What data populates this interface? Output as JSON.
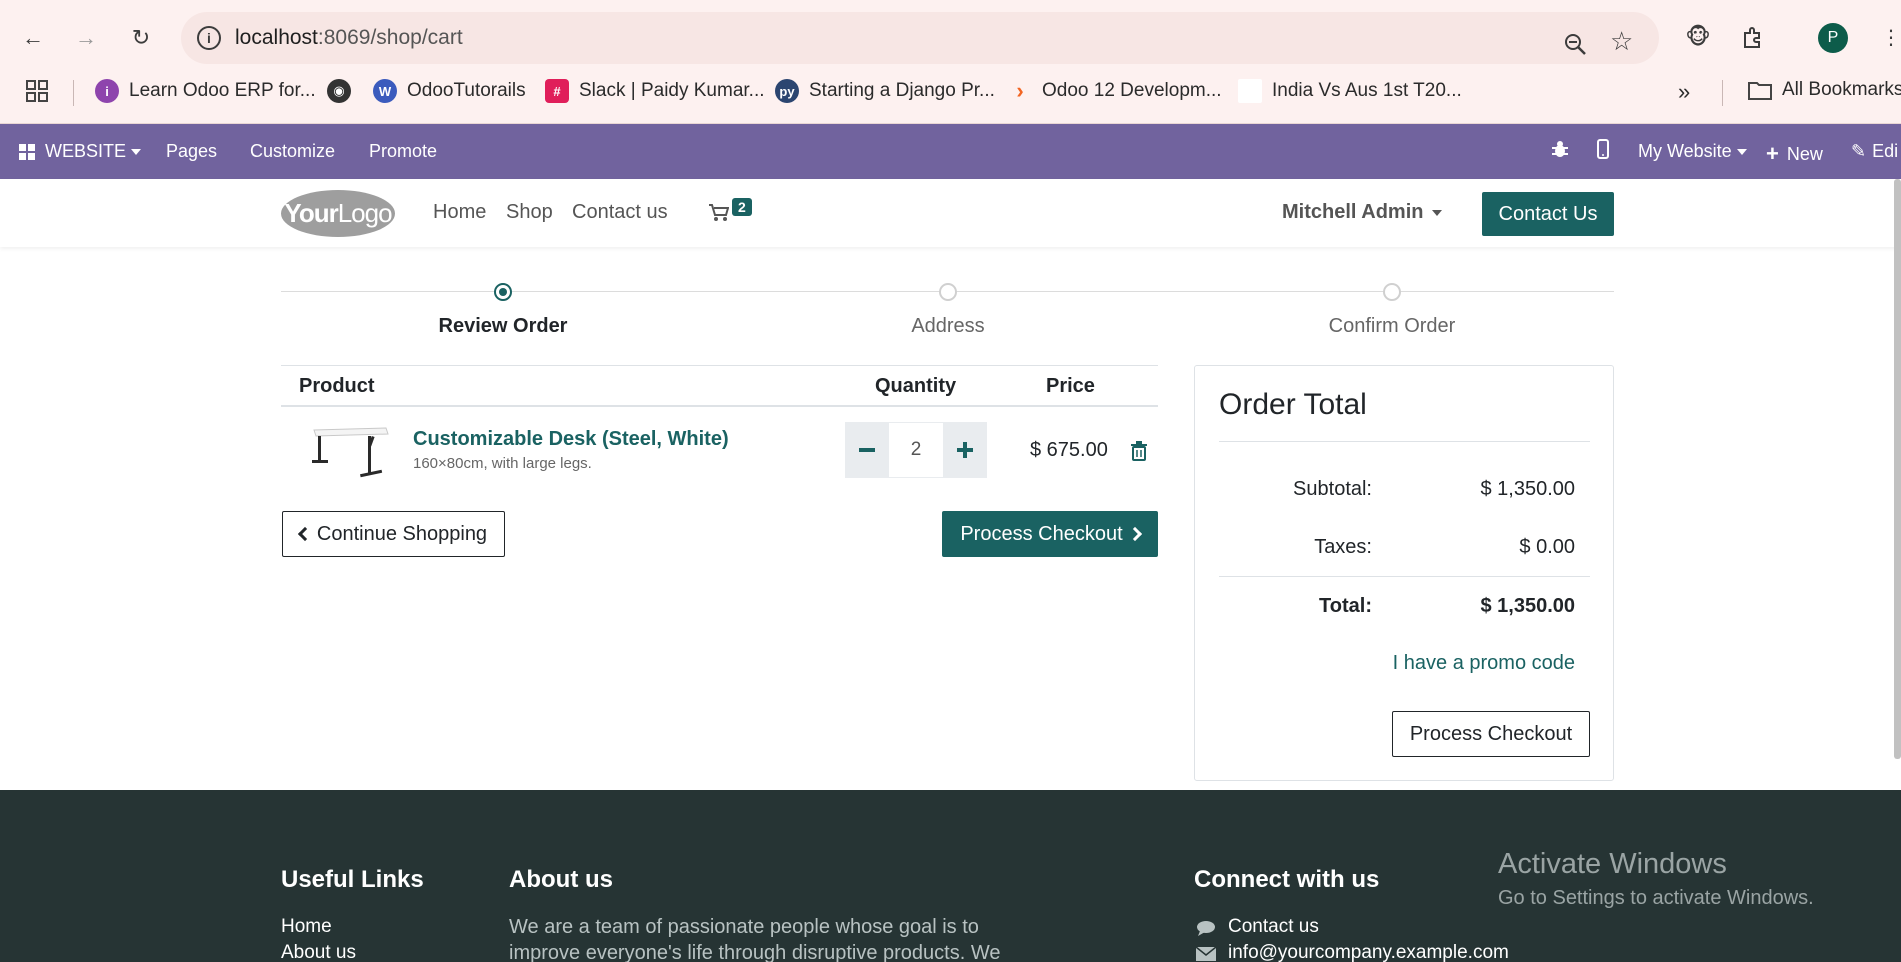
{
  "browser": {
    "url_host": "localhost",
    "url_rest": ":8069/shop/cart",
    "profile_initial": "P",
    "bookmarks": [
      {
        "label": "Learn Odoo ERP for...",
        "color": "#8e44ad"
      },
      {
        "label": "",
        "color": "#333333"
      },
      {
        "label": "OdooTutorails",
        "color": "#3b5bbd"
      },
      {
        "label": "Slack | Paidy Kumar...",
        "color": "#e01e5a"
      },
      {
        "label": "Starting a Django Pr...",
        "color": "#2b4570"
      },
      {
        "label": "Odoo 12 Developm...",
        "color": "#f26522"
      },
      {
        "label": "India Vs Aus 1st T20...",
        "color": "#ffffff"
      }
    ],
    "all_bookmarks": "All Bookmarks"
  },
  "admin_bar": {
    "website": "WEBSITE",
    "pages": "Pages",
    "customize": "Customize",
    "promote": "Promote",
    "my_website": "My Website",
    "new": "New",
    "edit": "Edi"
  },
  "header": {
    "logo_bold": "Your",
    "logo_light": "Logo",
    "menu": [
      "Home",
      "Shop",
      "Contact us"
    ],
    "cart_count": "2",
    "user": "Mitchell Admin",
    "contact_button": "Contact Us"
  },
  "wizard": {
    "steps": [
      "Review Order",
      "Address",
      "Confirm Order"
    ],
    "active_index": 0
  },
  "cart": {
    "columns": {
      "product": "Product",
      "quantity": "Quantity",
      "price": "Price"
    },
    "lines": [
      {
        "name": "Customizable Desk (Steel, White)",
        "description": "160×80cm, with large legs.",
        "quantity": "2",
        "price": "$ 675.00"
      }
    ],
    "continue_label": "Continue Shopping",
    "checkout_label": "Process Checkout"
  },
  "summary": {
    "title": "Order Total",
    "subtotal_label": "Subtotal:",
    "subtotal": "$ 1,350.00",
    "taxes_label": "Taxes:",
    "taxes": "$ 0.00",
    "total_label": "Total:",
    "total": "$ 1,350.00",
    "promo_label": "I have a promo code",
    "checkout_label": "Process Checkout"
  },
  "footer": {
    "useful_links_title": "Useful Links",
    "useful_links": [
      "Home",
      "About us"
    ],
    "about_title": "About us",
    "about_text": "We are a team of passionate people whose goal is to improve everyone's life through disruptive products. We",
    "connect_title": "Connect with us",
    "connect_items": [
      "Contact us",
      "info@yourcompany.example.com"
    ]
  },
  "watermark": {
    "line1": "Activate Windows",
    "line2": "Go to Settings to activate Windows."
  },
  "colors": {
    "brand": "#1a6262",
    "admin_bar": "#71639e",
    "footer_bg": "#263434"
  }
}
